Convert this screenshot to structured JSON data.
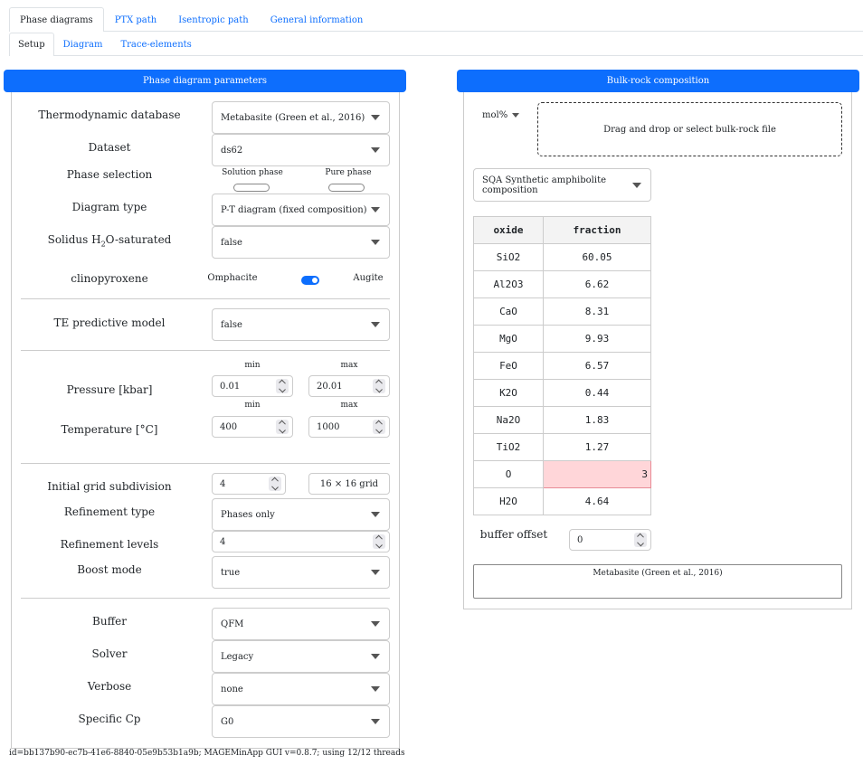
{
  "top_tabs": [
    "Phase diagrams",
    "PTX path",
    "Isentropic path",
    "General information"
  ],
  "sub_tabs": [
    "Setup",
    "Diagram",
    "Trace-elements"
  ],
  "left_header": "Phase diagram parameters",
  "right_header": "Bulk-rock composition",
  "params": {
    "thermo_db_label": "Thermodynamic database",
    "thermo_db_value": "Metabasite (Green et al., 2016)",
    "dataset_label": "Dataset",
    "dataset_value": "ds62",
    "phase_selection_label": "Phase selection",
    "solution_phase_label": "Solution phase",
    "pure_phase_label": "Pure phase",
    "diagram_type_label": "Diagram type",
    "diagram_type_value": "P-T diagram (fixed composition)",
    "solidus_label_a": "Solidus H",
    "solidus_label_sub": "2",
    "solidus_label_b": "O-saturated",
    "solidus_value": "false",
    "cpx_label": "clinopyroxene",
    "cpx_left": "Omphacite",
    "cpx_right": "Augite",
    "cpx_toggle_on": true,
    "te_model_label": "TE predictive model",
    "te_model_value": "false",
    "min_label": "min",
    "max_label": "max",
    "pressure_label": "Pressure [kbar]",
    "pressure_min": "0.01",
    "pressure_max": "20.01",
    "temperature_label": "Temperature [°C]",
    "temperature_min": "400",
    "temperature_max": "1000",
    "grid_label": "Initial grid subdivision",
    "grid_value": "4",
    "grid_display": "16 × 16 grid",
    "refinement_type_label": "Refinement type",
    "refinement_type_value": "Phases only",
    "refinement_levels_label": "Refinement levels",
    "refinement_levels_value": "4",
    "boost_label": "Boost mode",
    "boost_value": "true",
    "buffer_label": "Buffer",
    "buffer_value": "QFM",
    "solver_label": "Solver",
    "solver_value": "Legacy",
    "verbose_label": "Verbose",
    "verbose_value": "none",
    "cp_label": "Specific Cp",
    "cp_value": "G0"
  },
  "bulk": {
    "unit": "mol%",
    "dropzone": "Drag and drop or select bulk-rock file",
    "preset": "SQA Synthetic amphibolite composition",
    "columns": [
      "oxide",
      "fraction"
    ],
    "rows": [
      [
        "SiO2",
        "60.05"
      ],
      [
        "Al2O3",
        "6.62"
      ],
      [
        "CaO",
        "8.31"
      ],
      [
        "MgO",
        "9.93"
      ],
      [
        "FeO",
        "6.57"
      ],
      [
        "K2O",
        "0.44"
      ],
      [
        "Na2O",
        "1.83"
      ],
      [
        "TiO2",
        "1.27"
      ],
      [
        "O",
        "3"
      ],
      [
        "H2O",
        "4.64"
      ]
    ],
    "buffer_offset_label": "buffer offset",
    "buffer_offset_value": "0",
    "db_note": "Metabasite (Green et al., 2016)"
  },
  "footer": "id=bb137b90-ec7b-41e6-8840-05e9b53b1a9b; MAGEMinApp GUI v=0.8.7; using 12/12 threads",
  "colors": {
    "accent": "#0d6efd",
    "highlight_cell": "#ffd6d9"
  }
}
